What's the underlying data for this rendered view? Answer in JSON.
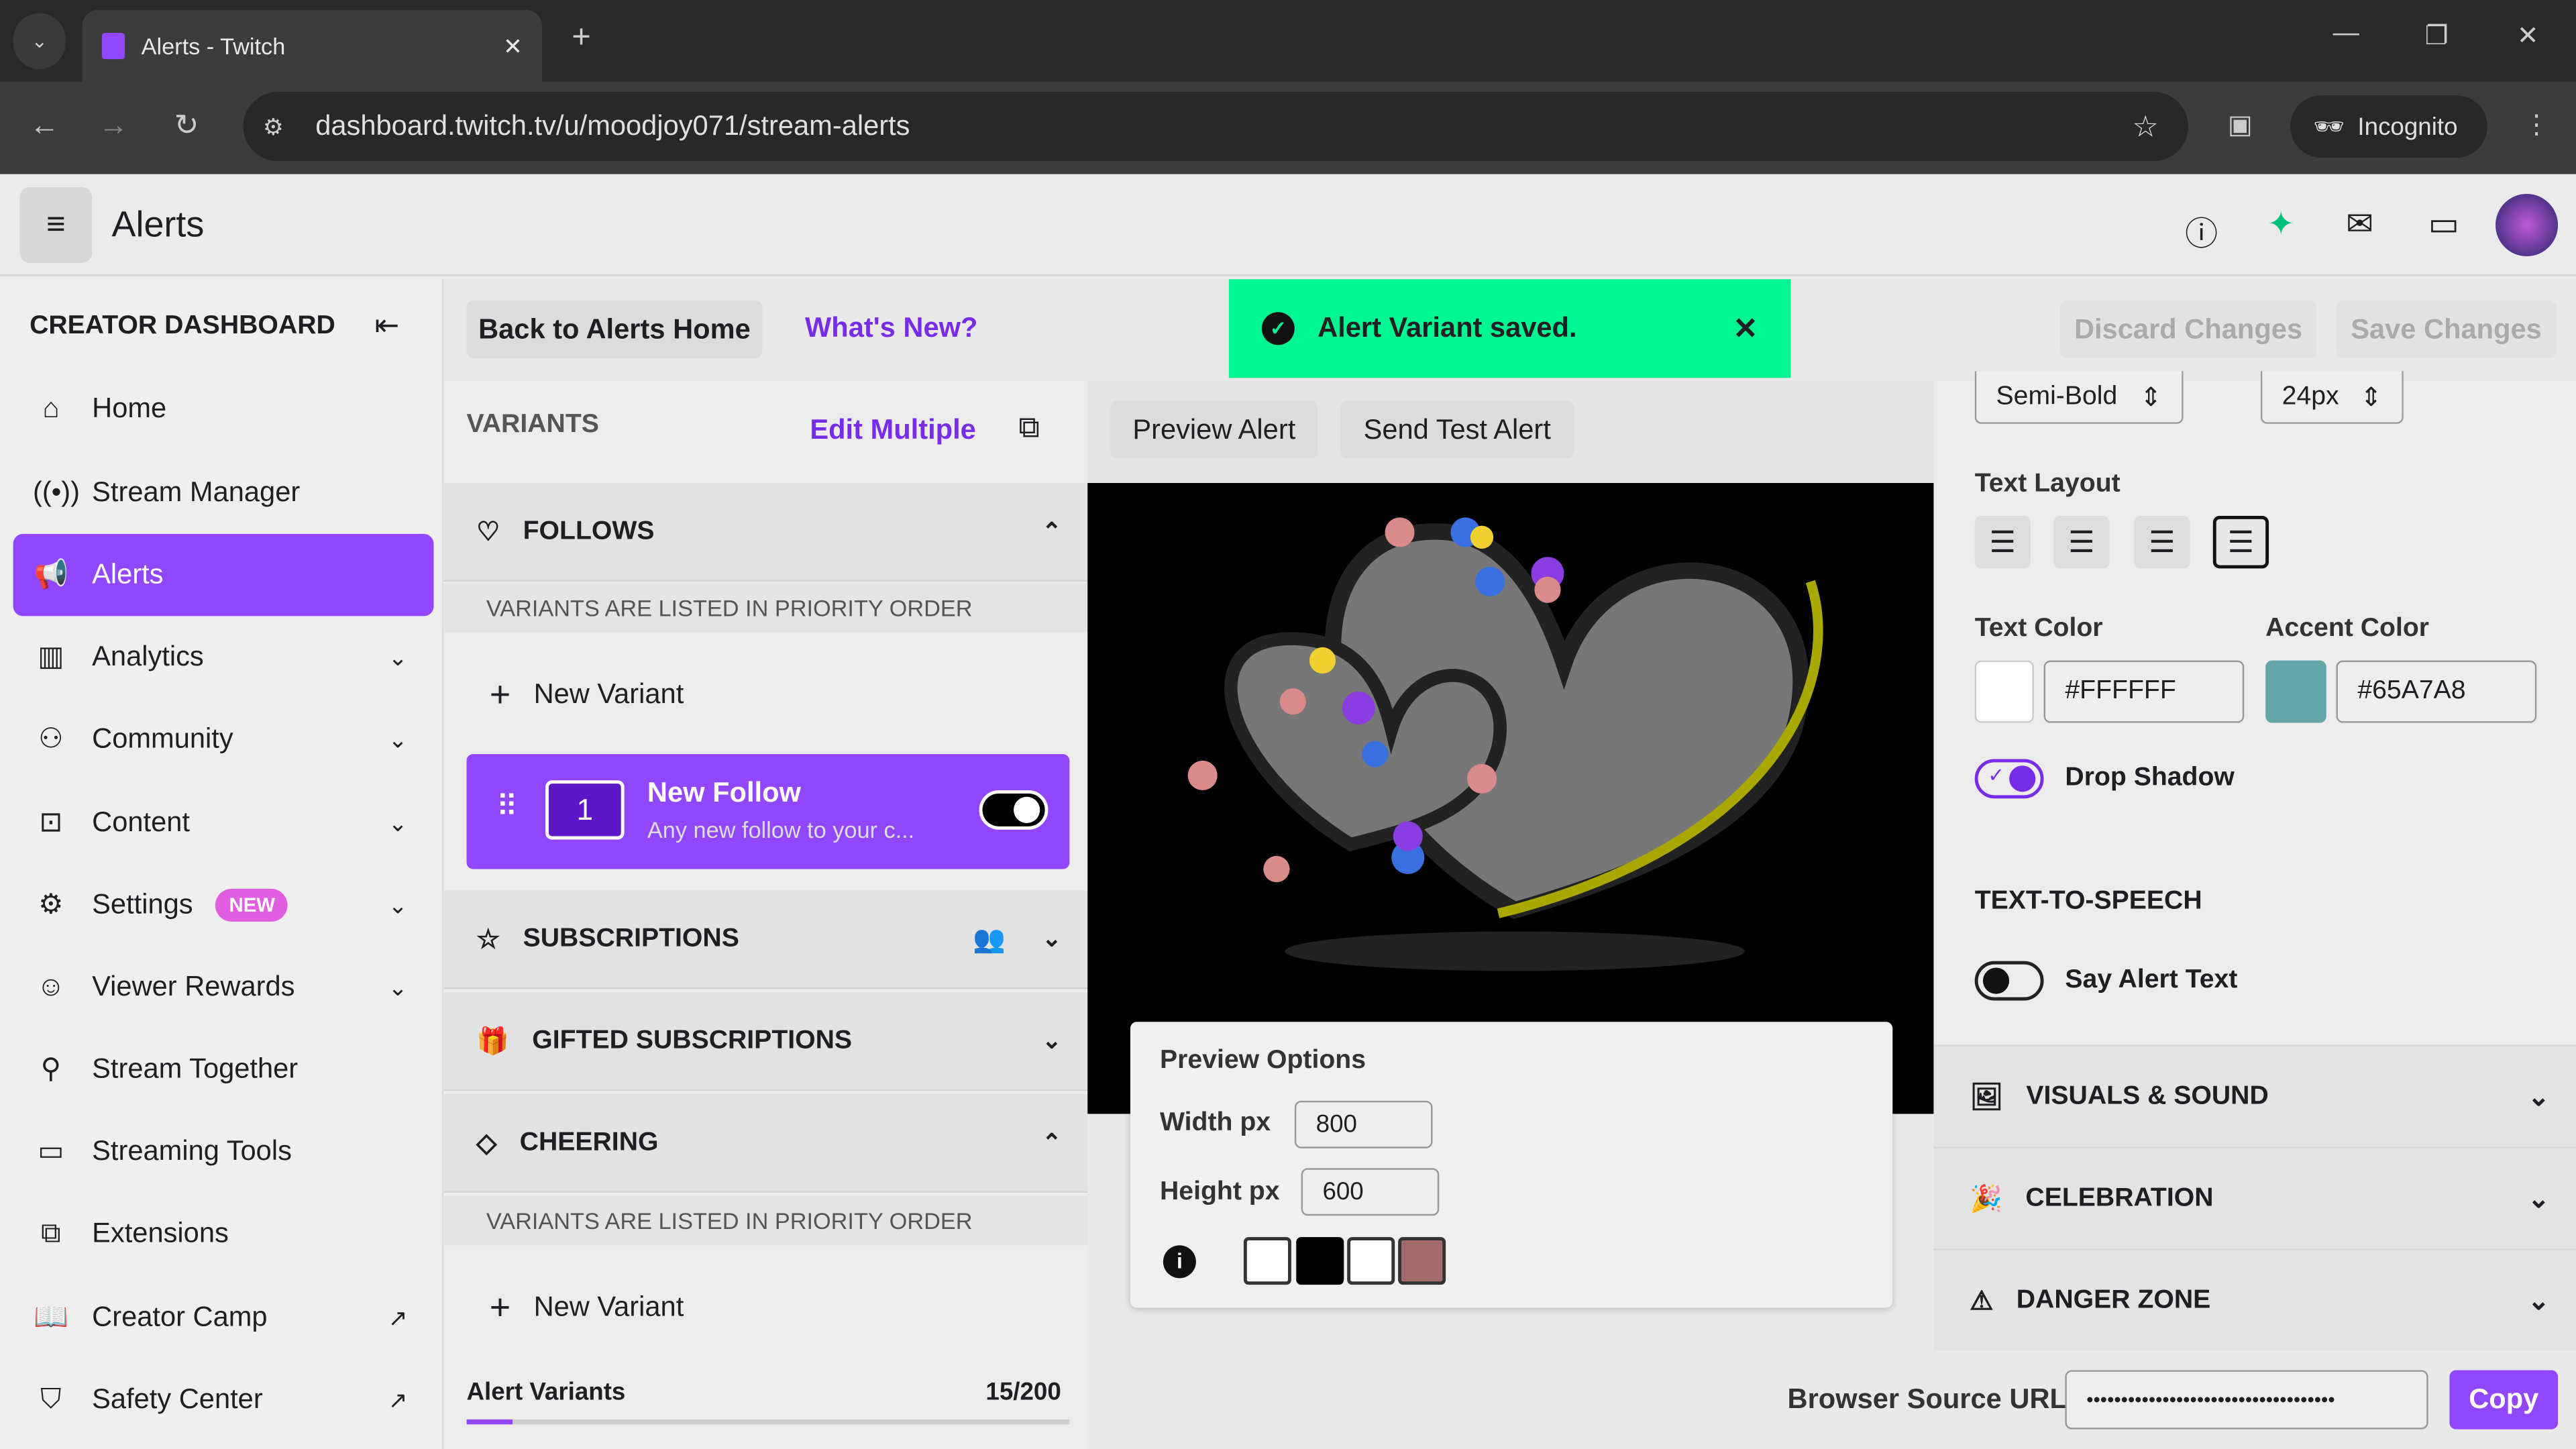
{
  "browser": {
    "tab_title": "Alerts - Twitch",
    "url": "dashboard.twitch.tv/u/moodjoy071/stream-alerts",
    "profile": "Incognito"
  },
  "header": {
    "title": "Alerts"
  },
  "sidebar": {
    "title": "CREATOR DASHBOARD",
    "items": [
      {
        "label": "Home",
        "icon": "home-icon"
      },
      {
        "label": "Stream Manager",
        "icon": "broadcast-icon"
      },
      {
        "label": "Alerts",
        "icon": "megaphone-icon",
        "active": true
      },
      {
        "label": "Analytics",
        "icon": "chart-icon"
      },
      {
        "label": "Community",
        "icon": "community-icon"
      },
      {
        "label": "Content",
        "icon": "content-icon"
      },
      {
        "label": "Settings",
        "icon": "gear-icon",
        "badge": "NEW"
      },
      {
        "label": "Viewer Rewards",
        "icon": "rewards-icon"
      },
      {
        "label": "Stream Together",
        "icon": "add-user-icon"
      },
      {
        "label": "Streaming Tools",
        "icon": "camera-icon"
      },
      {
        "label": "Extensions",
        "icon": "puzzle-icon"
      },
      {
        "label": "Creator Camp",
        "icon": "book-icon"
      },
      {
        "label": "Safety Center",
        "icon": "shield-icon"
      }
    ]
  },
  "toolbar": {
    "back": "Back to Alerts Home",
    "whats_new": "What's New?",
    "discard": "Discard Changes",
    "save": "Save Changes"
  },
  "toast": {
    "message": "Alert Variant saved.",
    "color": "#00f593"
  },
  "variants": {
    "title": "VARIANTS",
    "edit_multiple": "Edit Multiple",
    "follows": "FOLLOWS",
    "priority_note": "VARIANTS ARE LISTED IN PRIORITY ORDER",
    "new_variant": "New Variant",
    "card": {
      "number": "1",
      "title": "New Follow",
      "subtitle": "Any new follow to your c...",
      "enabled": true
    },
    "subscriptions": "SUBSCRIPTIONS",
    "gifted": "GIFTED SUBSCRIPTIONS",
    "cheering": "CHEERING",
    "count_label": "Alert Variants",
    "count": "15/200",
    "count_fraction": 0.075
  },
  "preview": {
    "preview_alert": "Preview Alert",
    "send_test": "Send Test Alert",
    "options_title": "Preview Options",
    "width_label": "Width px",
    "width": "800",
    "height_label": "Height px",
    "height": "600"
  },
  "settings": {
    "font_weight": "Semi-Bold",
    "font_size": "24px",
    "text_layout": "Text Layout",
    "text_color_label": "Text Color",
    "text_color": "#FFFFFF",
    "accent_color_label": "Accent Color",
    "accent_color": "#65A7A8",
    "drop_shadow": "Drop Shadow",
    "drop_shadow_on": true,
    "tts_title": "TEXT-TO-SPEECH",
    "say_alert": "Say Alert Text",
    "say_alert_on": false,
    "visuals": "VISUALS & SOUND",
    "celebration": "CELEBRATION",
    "danger": "DANGER ZONE"
  },
  "footer": {
    "browser_source_label": "Browser Source URL",
    "browser_source_value": "••••••••••••••••••••••••••••••••••••",
    "copy": "Copy"
  }
}
